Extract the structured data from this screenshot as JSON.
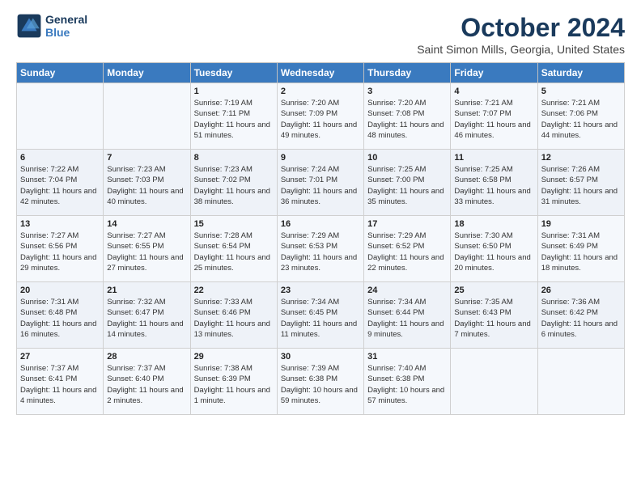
{
  "logo": {
    "line1": "General",
    "line2": "Blue"
  },
  "title": "October 2024",
  "subtitle": "Saint Simon Mills, Georgia, United States",
  "days_header": [
    "Sunday",
    "Monday",
    "Tuesday",
    "Wednesday",
    "Thursday",
    "Friday",
    "Saturday"
  ],
  "weeks": [
    [
      {
        "num": "",
        "sunrise": "",
        "sunset": "",
        "daylight": ""
      },
      {
        "num": "",
        "sunrise": "",
        "sunset": "",
        "daylight": ""
      },
      {
        "num": "1",
        "sunrise": "Sunrise: 7:19 AM",
        "sunset": "Sunset: 7:11 PM",
        "daylight": "Daylight: 11 hours and 51 minutes."
      },
      {
        "num": "2",
        "sunrise": "Sunrise: 7:20 AM",
        "sunset": "Sunset: 7:09 PM",
        "daylight": "Daylight: 11 hours and 49 minutes."
      },
      {
        "num": "3",
        "sunrise": "Sunrise: 7:20 AM",
        "sunset": "Sunset: 7:08 PM",
        "daylight": "Daylight: 11 hours and 48 minutes."
      },
      {
        "num": "4",
        "sunrise": "Sunrise: 7:21 AM",
        "sunset": "Sunset: 7:07 PM",
        "daylight": "Daylight: 11 hours and 46 minutes."
      },
      {
        "num": "5",
        "sunrise": "Sunrise: 7:21 AM",
        "sunset": "Sunset: 7:06 PM",
        "daylight": "Daylight: 11 hours and 44 minutes."
      }
    ],
    [
      {
        "num": "6",
        "sunrise": "Sunrise: 7:22 AM",
        "sunset": "Sunset: 7:04 PM",
        "daylight": "Daylight: 11 hours and 42 minutes."
      },
      {
        "num": "7",
        "sunrise": "Sunrise: 7:23 AM",
        "sunset": "Sunset: 7:03 PM",
        "daylight": "Daylight: 11 hours and 40 minutes."
      },
      {
        "num": "8",
        "sunrise": "Sunrise: 7:23 AM",
        "sunset": "Sunset: 7:02 PM",
        "daylight": "Daylight: 11 hours and 38 minutes."
      },
      {
        "num": "9",
        "sunrise": "Sunrise: 7:24 AM",
        "sunset": "Sunset: 7:01 PM",
        "daylight": "Daylight: 11 hours and 36 minutes."
      },
      {
        "num": "10",
        "sunrise": "Sunrise: 7:25 AM",
        "sunset": "Sunset: 7:00 PM",
        "daylight": "Daylight: 11 hours and 35 minutes."
      },
      {
        "num": "11",
        "sunrise": "Sunrise: 7:25 AM",
        "sunset": "Sunset: 6:58 PM",
        "daylight": "Daylight: 11 hours and 33 minutes."
      },
      {
        "num": "12",
        "sunrise": "Sunrise: 7:26 AM",
        "sunset": "Sunset: 6:57 PM",
        "daylight": "Daylight: 11 hours and 31 minutes."
      }
    ],
    [
      {
        "num": "13",
        "sunrise": "Sunrise: 7:27 AM",
        "sunset": "Sunset: 6:56 PM",
        "daylight": "Daylight: 11 hours and 29 minutes."
      },
      {
        "num": "14",
        "sunrise": "Sunrise: 7:27 AM",
        "sunset": "Sunset: 6:55 PM",
        "daylight": "Daylight: 11 hours and 27 minutes."
      },
      {
        "num": "15",
        "sunrise": "Sunrise: 7:28 AM",
        "sunset": "Sunset: 6:54 PM",
        "daylight": "Daylight: 11 hours and 25 minutes."
      },
      {
        "num": "16",
        "sunrise": "Sunrise: 7:29 AM",
        "sunset": "Sunset: 6:53 PM",
        "daylight": "Daylight: 11 hours and 23 minutes."
      },
      {
        "num": "17",
        "sunrise": "Sunrise: 7:29 AM",
        "sunset": "Sunset: 6:52 PM",
        "daylight": "Daylight: 11 hours and 22 minutes."
      },
      {
        "num": "18",
        "sunrise": "Sunrise: 7:30 AM",
        "sunset": "Sunset: 6:50 PM",
        "daylight": "Daylight: 11 hours and 20 minutes."
      },
      {
        "num": "19",
        "sunrise": "Sunrise: 7:31 AM",
        "sunset": "Sunset: 6:49 PM",
        "daylight": "Daylight: 11 hours and 18 minutes."
      }
    ],
    [
      {
        "num": "20",
        "sunrise": "Sunrise: 7:31 AM",
        "sunset": "Sunset: 6:48 PM",
        "daylight": "Daylight: 11 hours and 16 minutes."
      },
      {
        "num": "21",
        "sunrise": "Sunrise: 7:32 AM",
        "sunset": "Sunset: 6:47 PM",
        "daylight": "Daylight: 11 hours and 14 minutes."
      },
      {
        "num": "22",
        "sunrise": "Sunrise: 7:33 AM",
        "sunset": "Sunset: 6:46 PM",
        "daylight": "Daylight: 11 hours and 13 minutes."
      },
      {
        "num": "23",
        "sunrise": "Sunrise: 7:34 AM",
        "sunset": "Sunset: 6:45 PM",
        "daylight": "Daylight: 11 hours and 11 minutes."
      },
      {
        "num": "24",
        "sunrise": "Sunrise: 7:34 AM",
        "sunset": "Sunset: 6:44 PM",
        "daylight": "Daylight: 11 hours and 9 minutes."
      },
      {
        "num": "25",
        "sunrise": "Sunrise: 7:35 AM",
        "sunset": "Sunset: 6:43 PM",
        "daylight": "Daylight: 11 hours and 7 minutes."
      },
      {
        "num": "26",
        "sunrise": "Sunrise: 7:36 AM",
        "sunset": "Sunset: 6:42 PM",
        "daylight": "Daylight: 11 hours and 6 minutes."
      }
    ],
    [
      {
        "num": "27",
        "sunrise": "Sunrise: 7:37 AM",
        "sunset": "Sunset: 6:41 PM",
        "daylight": "Daylight: 11 hours and 4 minutes."
      },
      {
        "num": "28",
        "sunrise": "Sunrise: 7:37 AM",
        "sunset": "Sunset: 6:40 PM",
        "daylight": "Daylight: 11 hours and 2 minutes."
      },
      {
        "num": "29",
        "sunrise": "Sunrise: 7:38 AM",
        "sunset": "Sunset: 6:39 PM",
        "daylight": "Daylight: 11 hours and 1 minute."
      },
      {
        "num": "30",
        "sunrise": "Sunrise: 7:39 AM",
        "sunset": "Sunset: 6:38 PM",
        "daylight": "Daylight: 10 hours and 59 minutes."
      },
      {
        "num": "31",
        "sunrise": "Sunrise: 7:40 AM",
        "sunset": "Sunset: 6:38 PM",
        "daylight": "Daylight: 10 hours and 57 minutes."
      },
      {
        "num": "",
        "sunrise": "",
        "sunset": "",
        "daylight": ""
      },
      {
        "num": "",
        "sunrise": "",
        "sunset": "",
        "daylight": ""
      }
    ]
  ]
}
